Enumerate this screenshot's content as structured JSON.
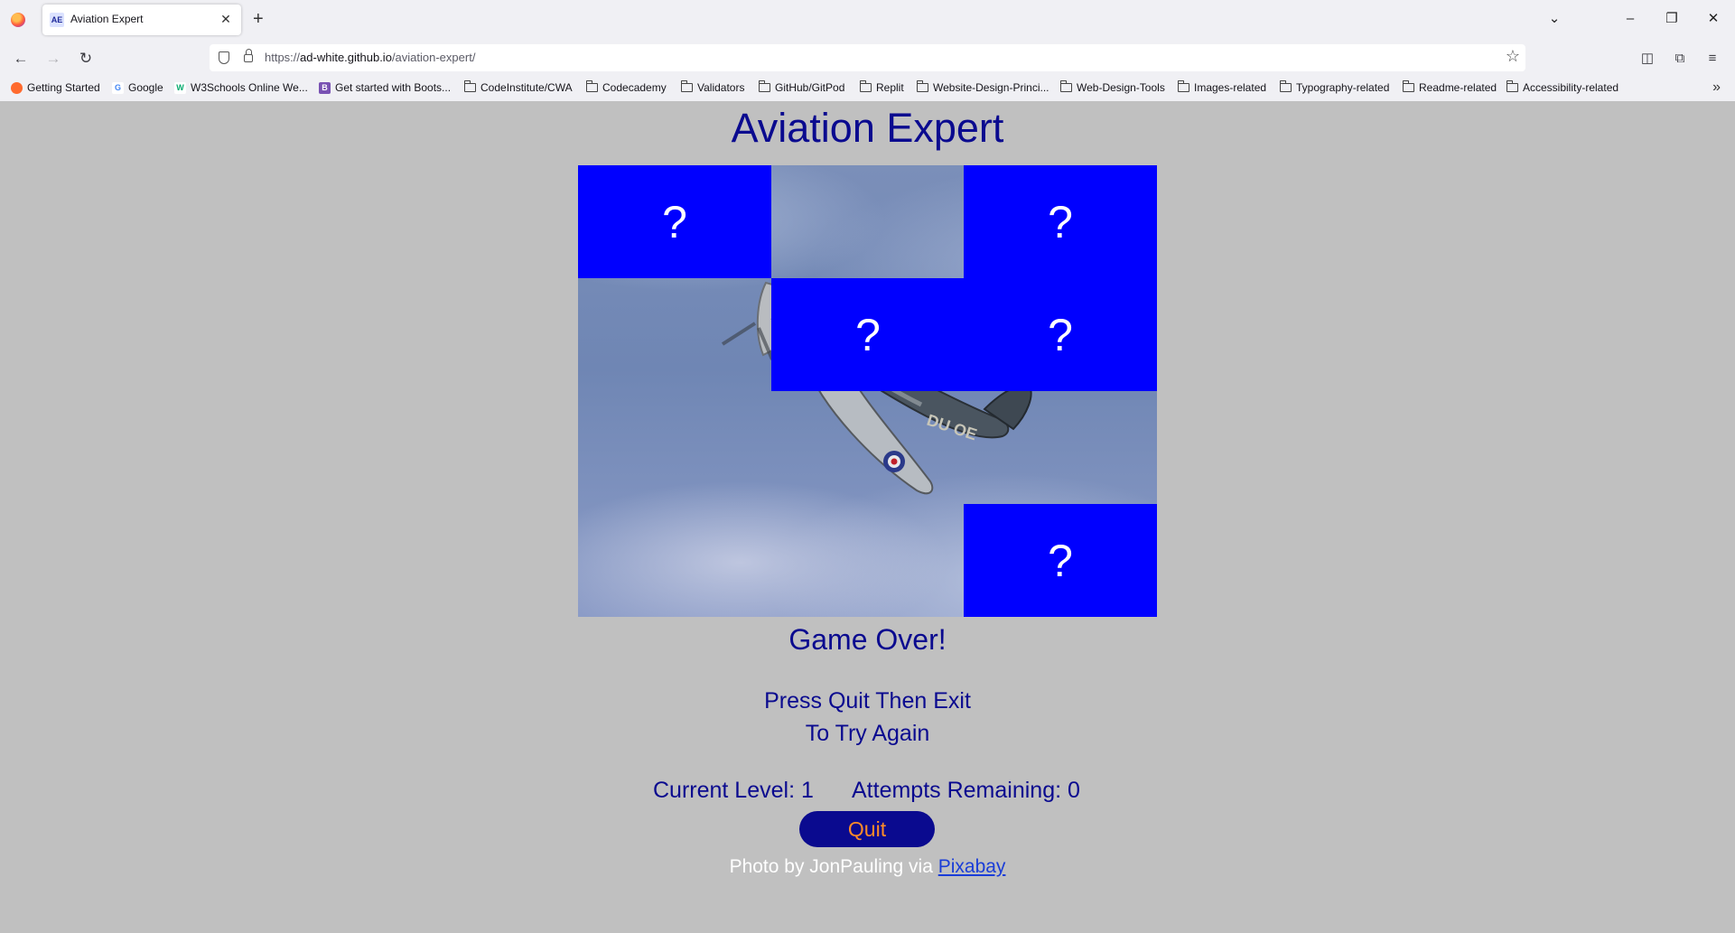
{
  "browser": {
    "tab_title": "Aviation Expert",
    "tab_favicon_text": "AE",
    "url_prefix": "https://",
    "url_host": "ad-white.github.io",
    "url_path": "/aviation-expert/",
    "bookmarks": [
      "Getting Started",
      "Google",
      "W3Schools Online We...",
      "Get started with Boots...",
      "CodeInstitute/CWA",
      "Codecademy",
      "Validators",
      "GitHub/GitPod",
      "Replit",
      "Website-Design-Princi...",
      "Web-Design-Tools",
      "Images-related",
      "Typography-related",
      "Readme-related",
      "Accessibility-related"
    ]
  },
  "game": {
    "title": "Aviation Expert",
    "tile_symbol": "?",
    "game_over": "Game Over!",
    "instruction_line1": "Press Quit Then Exit",
    "instruction_line2": "To Try Again",
    "current_level_label": "Current Level: 1",
    "attempts_label": "Attempts Remaining: 0",
    "quit_label": "Quit",
    "credit_text": "Photo by JonPauling via ",
    "credit_link": "Pixabay",
    "grid": {
      "rows": 4,
      "cols": 3,
      "hidden_tiles": [
        [
          0,
          0
        ],
        [
          0,
          2
        ],
        [
          1,
          1
        ],
        [
          1,
          2
        ],
        [
          3,
          2
        ]
      ]
    }
  },
  "colors": {
    "page_bg": "#c0c0c0",
    "title_text": "#0a0a8f",
    "tile_bg": "#0000ff",
    "quit_bg": "#0a0a8f",
    "quit_text": "#ff8c28",
    "link": "#1a3dd8"
  }
}
